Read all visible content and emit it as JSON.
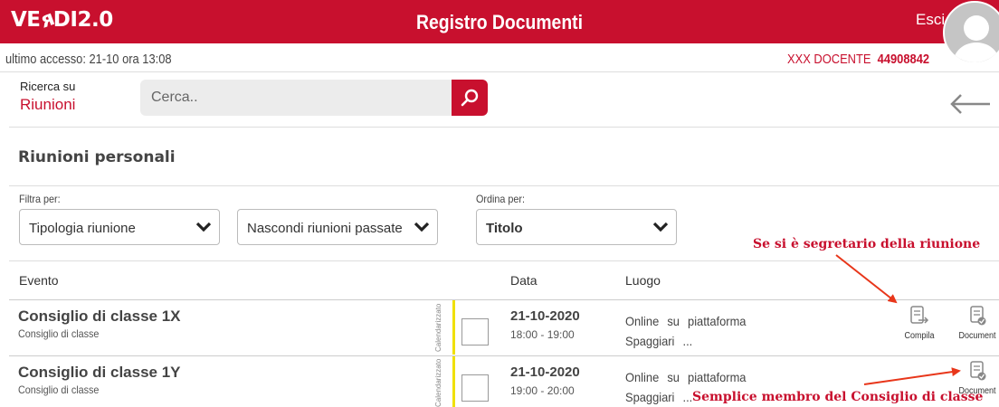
{
  "header": {
    "logo": "VE🡵DI2.0",
    "logo_text": "VERDI2.0",
    "title": "Registro Documenti",
    "logout": "Esci",
    "brand_color": "#c8102e"
  },
  "user_bar": {
    "last_access": "ultimo accesso: 21-10 ora 13:08",
    "role": "XXX DOCENTE",
    "code": "44908842"
  },
  "search": {
    "label_small": "Ricerca su",
    "label_big": "Riunioni",
    "placeholder": "Cerca.."
  },
  "section": {
    "title": "Riunioni personali"
  },
  "filters": {
    "filter_label": "Filtra per:",
    "sort_label": "Ordina per:",
    "type_value": "Tipologia riunione",
    "past_value": "Nascondi riunioni passate",
    "sort_value": "Titolo"
  },
  "annotations": {
    "secretary": "Se si è segretario della riunione",
    "member": "Semplice membro del Consiglio di classe"
  },
  "table": {
    "headers": {
      "event": "Evento",
      "date": "Data",
      "place": "Luogo"
    },
    "rows": [
      {
        "title": "Consiglio di classe 1X",
        "subtitle": "Consiglio di classe",
        "status": "Calendarizzato",
        "date": "21-10-2020",
        "time": "18:00 - 19:00",
        "place_line1": "Online su piattaforma",
        "place_line2": "Spaggiari ...",
        "action_compile": "Compila",
        "action_document": "Document"
      },
      {
        "title": "Consiglio di classe 1Y",
        "subtitle": "Consiglio di classe",
        "status": "Calendarizzato",
        "date": "21-10-2020",
        "time": "19:00 - 20:00",
        "place_line1": "Online su piattaforma",
        "place_line2": "Spaggiari ...",
        "action_document": "Document"
      }
    ]
  }
}
